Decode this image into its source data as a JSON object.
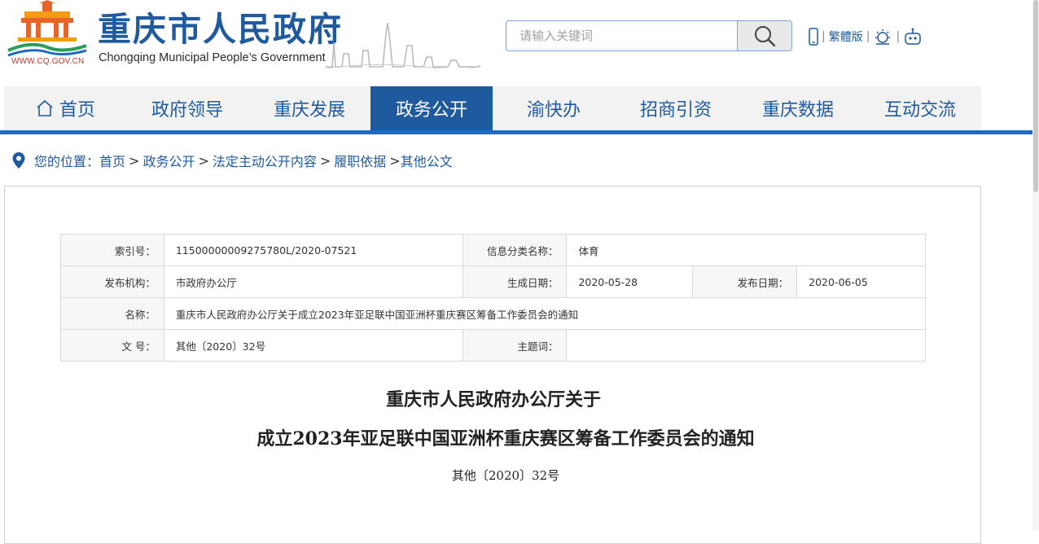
{
  "header": {
    "logo_url_text": "WWW.CQ.GOV.CN",
    "site_title": "重庆市人民政府",
    "site_subtitle": "Chongqing Municipal People’s Government",
    "search_placeholder": "请输入关键词",
    "tools": {
      "traditional_label": "繁體版"
    },
    "colors": {
      "brand_blue": "#1f5a9e",
      "accent_blue": "#1f6bc0",
      "logo_red": "#c0392b",
      "logo_orange": "#f39c12"
    }
  },
  "nav": {
    "items": [
      {
        "label": "首页"
      },
      {
        "label": "政府领导"
      },
      {
        "label": "重庆发展"
      },
      {
        "label": "政务公开"
      },
      {
        "label": "渝快办"
      },
      {
        "label": "招商引资"
      },
      {
        "label": "重庆数据"
      },
      {
        "label": "互动交流"
      }
    ],
    "active_index": 3
  },
  "breadcrumb": {
    "prefix": "您的位置：",
    "items": [
      "首页",
      "政务公开",
      "法定主动公开内容",
      "履职依据",
      "其他公文"
    ]
  },
  "meta": {
    "index_label": "索引号：",
    "index_value": "11500000009275780L/2020-07521",
    "category_label": "信息分类名称：",
    "category_value": "体育",
    "org_label": "发布机构：",
    "org_value": "市政府办公厅",
    "created_label": "生成日期：",
    "created_value": "2020-05-28",
    "published_label": "发布日期：",
    "published_value": "2020-06-05",
    "name_label": "名称：",
    "name_value": "重庆市人民政府办公厅关于成立2023年亚足联中国亚洲杯重庆赛区筹备工作委员会的通知",
    "docno_label": "文 号：",
    "docno_value": "其他〔2020〕32号",
    "subject_label": "主题词：",
    "subject_value": ""
  },
  "document": {
    "title_line1": "重庆市人民政府办公厅关于",
    "title_line2": "成立2023年亚足联中国亚洲杯重庆赛区筹备工作委员会的通知",
    "doc_number": "其他〔2020〕32号"
  }
}
